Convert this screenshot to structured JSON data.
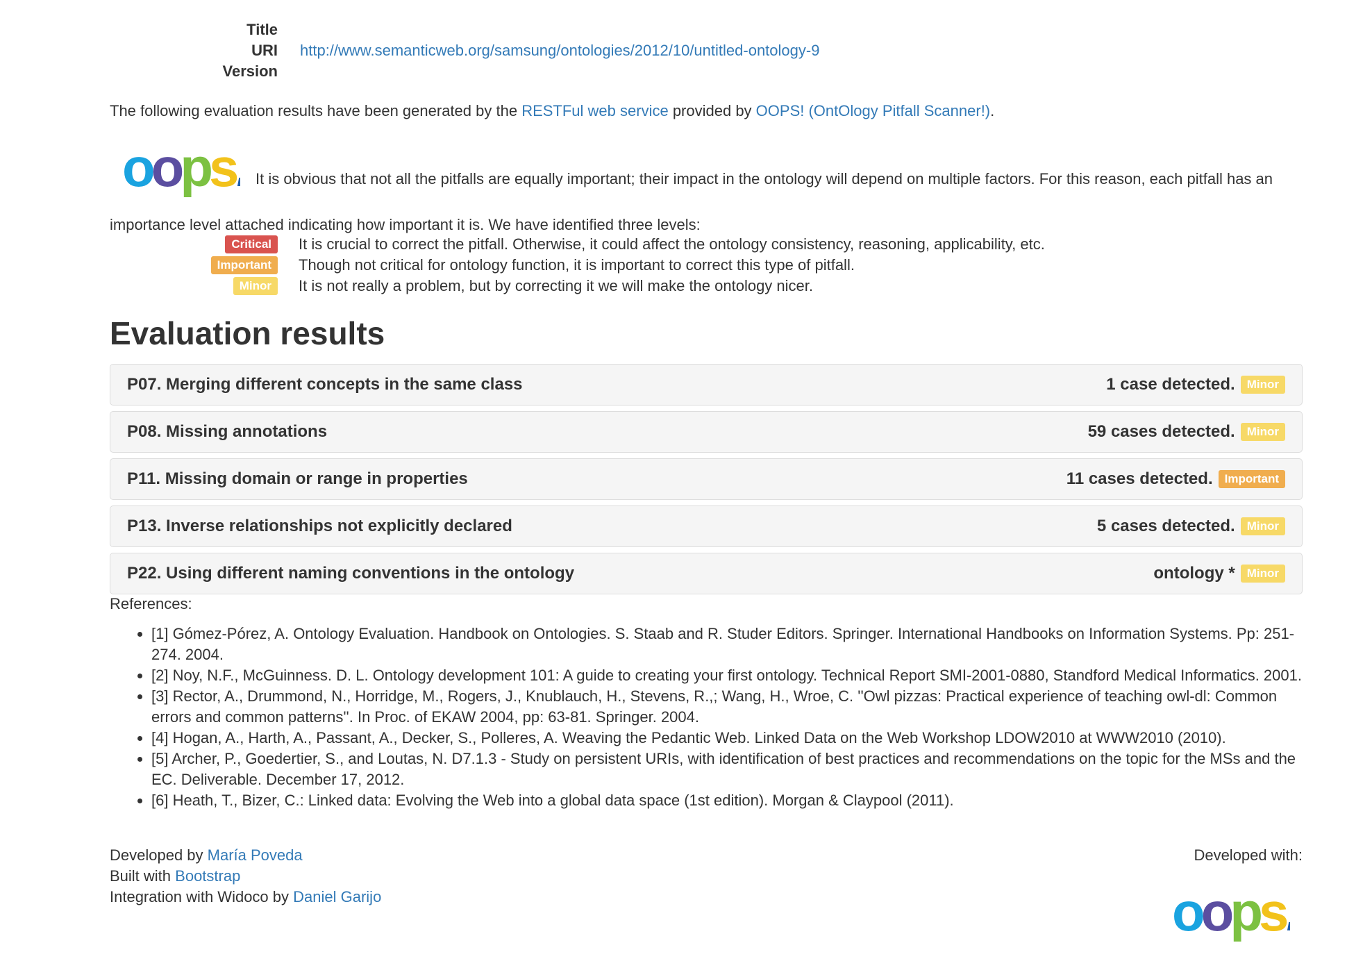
{
  "metadata": {
    "title_label": "Title",
    "uri_label": "URI",
    "version_label": "Version",
    "uri_value": "http://www.semanticweb.org/samsung/ontologies/2012/10/untitled-ontology-9"
  },
  "intro": {
    "text_before": "The following evaluation results have been generated by the ",
    "restful_link": "RESTFul web service",
    "text_middle": " provided by ",
    "oops_link": "OOPS! (OntOlogy Pitfall Scanner!)",
    "text_after": "."
  },
  "importance_text": "It is obvious that not all the pitfalls are equally important; their impact in the ontology will depend on multiple factors. For this reason, each pitfall has an importance level attached indicating how important it is. We have identified three levels:",
  "levels": [
    {
      "badge": "Critical",
      "description": "It is crucial to correct the pitfall. Otherwise, it could affect the ontology consistency, reasoning, applicability, etc."
    },
    {
      "badge": "Important",
      "description": "Though not critical for ontology function, it is important to correct this type of pitfall."
    },
    {
      "badge": "Minor",
      "description": "It is not really a problem, but by correcting it we will make the ontology nicer."
    }
  ],
  "evaluation_title": "Evaluation results",
  "results": [
    {
      "title": "P07. Merging different concepts in the same class",
      "count": "1 case detected.",
      "level": "Minor"
    },
    {
      "title": "P08. Missing annotations",
      "count": "59 cases detected.",
      "level": "Minor"
    },
    {
      "title": "P11. Missing domain or range in properties",
      "count": "11 cases detected.",
      "level": "Important"
    },
    {
      "title": "P13. Inverse relationships not explicitly declared",
      "count": "5 cases detected.",
      "level": "Minor"
    },
    {
      "title": "P22. Using different naming conventions in the ontology",
      "count": "ontology *",
      "level": "Minor"
    }
  ],
  "references_label": "References:",
  "references": [
    "[1] Gómez-Pórez, A. Ontology Evaluation. Handbook on Ontologies. S. Staab and R. Studer Editors. Springer. International Handbooks on Information Systems. Pp: 251-274. 2004.",
    "[2] Noy, N.F., McGuinness. D. L. Ontology development 101: A guide to creating your first ontology. Technical Report SMI-2001-0880, Standford Medical Informatics. 2001.",
    "[3] Rector, A., Drummond, N., Horridge, M., Rogers, J., Knublauch, H., Stevens, R.,; Wang, H., Wroe, C. ''Owl pizzas: Practical experience of teaching owl-dl: Common errors and common patterns''. In Proc. of EKAW 2004, pp: 63-81. Springer. 2004.",
    "[4] Hogan, A., Harth, A., Passant, A., Decker, S., Polleres, A. Weaving the Pedantic Web. Linked Data on the Web Workshop LDOW2010 at WWW2010 (2010).",
    "[5] Archer, P., Goedertier, S., and Loutas, N. D7.1.3 - Study on persistent URIs, with identification of best practices and recommendations on the topic for the MSs and the EC. Deliverable. December 17, 2012.",
    "[6] Heath, T., Bizer, C.: Linked data: Evolving the Web into a global data space (1st edition). Morgan & Claypool (2011)."
  ],
  "footer": {
    "developed_by_label": "Developed by ",
    "developed_by_link": "María Poveda",
    "built_with_label": "Built with ",
    "built_with_link": "Bootstrap",
    "integration_label": "Integration with Widoco by ",
    "integration_link": "Daniel Garijo",
    "developed_with_label": "Developed with:"
  },
  "logo": {
    "letters": [
      "o",
      "o",
      "p",
      "s",
      "!"
    ],
    "colors": [
      "#1aa3e0",
      "#5b4ea0",
      "#7cc142",
      "#f2c21b",
      "#1f5fae"
    ]
  },
  "colors": {
    "critical": "#d9534f",
    "important": "#f0ad4e",
    "minor": "#f7d967",
    "link": "#337ab7"
  }
}
